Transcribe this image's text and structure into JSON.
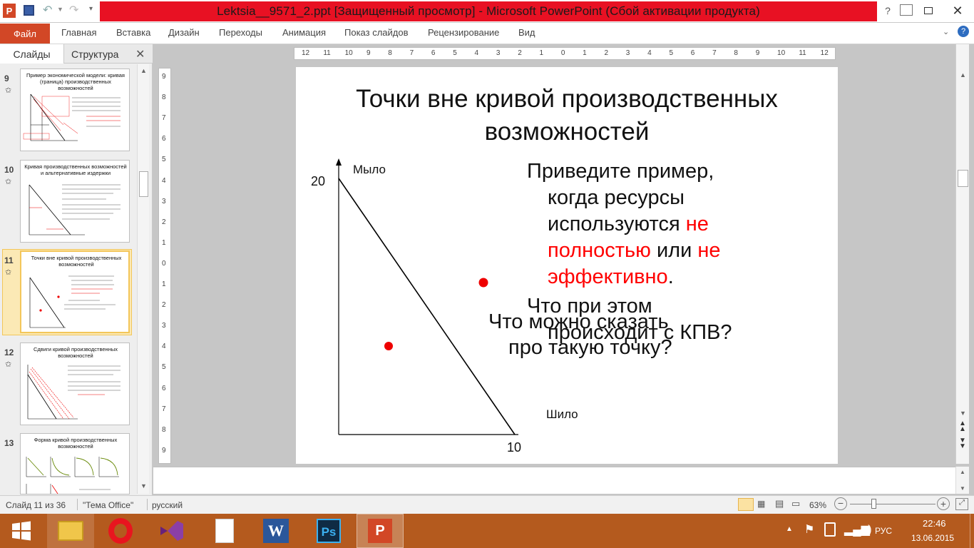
{
  "window": {
    "title": "Lektsia__9571_2.ppt [Защищенный просмотр] - Microsoft PowerPoint (Сбой активации продукта)",
    "app_icon_letter": "P"
  },
  "ribbon": {
    "file_tab": "Файл",
    "tabs": [
      "Главная",
      "Вставка",
      "Дизайн",
      "Переходы",
      "Анимация",
      "Показ слайдов",
      "Рецензирование",
      "Вид"
    ]
  },
  "left_panel": {
    "tab_slides": "Слайды",
    "tab_outline": "Структура",
    "thumbnails": [
      {
        "num": "9",
        "title": "Пример экономической модели: кривая (граница) производственных возможностей"
      },
      {
        "num": "10",
        "title": "Кривая производственных возможностей и альтернативные издержки"
      },
      {
        "num": "11",
        "title": "Точки вне кривой производственных возможностей"
      },
      {
        "num": "12",
        "title": "Сдвиги кривой производственных возможностей"
      },
      {
        "num": "13",
        "title": "Форма кривой производственных возможностей"
      }
    ]
  },
  "rulers": {
    "horizontal": [
      "12",
      "11",
      "10",
      "9",
      "8",
      "7",
      "6",
      "5",
      "4",
      "3",
      "2",
      "1",
      "0",
      "1",
      "2",
      "3",
      "4",
      "5",
      "6",
      "7",
      "8",
      "9",
      "10",
      "11",
      "12"
    ],
    "vertical": [
      "9",
      "8",
      "7",
      "6",
      "5",
      "4",
      "3",
      "2",
      "1",
      "0",
      "1",
      "2",
      "3",
      "4",
      "5",
      "6",
      "7",
      "8",
      "9"
    ]
  },
  "slide": {
    "title_line1": "Точки вне кривой производственных",
    "title_line2": "возможностей",
    "y_axis_label": "Мыло",
    "x_axis_label": "Шило",
    "y_intercept": "20",
    "x_intercept": "10",
    "q1_line1": "Приведите пример,",
    "q1_line2": "когда ресурсы",
    "q1_line3_a": "используются ",
    "q1_line3_b": "не",
    "q1_line4_a": "полностью",
    "q1_line4_b": " или ",
    "q1_line4_c": "не",
    "q1_line5_a": "эффективно",
    "q1_line5_b": ".",
    "q2_line1": "Что при этом",
    "q2_line2": "происходит с КПВ?",
    "q3_line1": "Что можно сказать",
    "q3_line2": "про такую точку?",
    "accent_color": "#ff0000"
  },
  "status": {
    "slide_counter": "Слайд 11 из 36",
    "theme": "\"Тема Office\"",
    "language": "русский",
    "zoom": "63%"
  },
  "taskbar": {
    "time": "22:46",
    "date": "13.06.2015",
    "lang": "РУС"
  }
}
